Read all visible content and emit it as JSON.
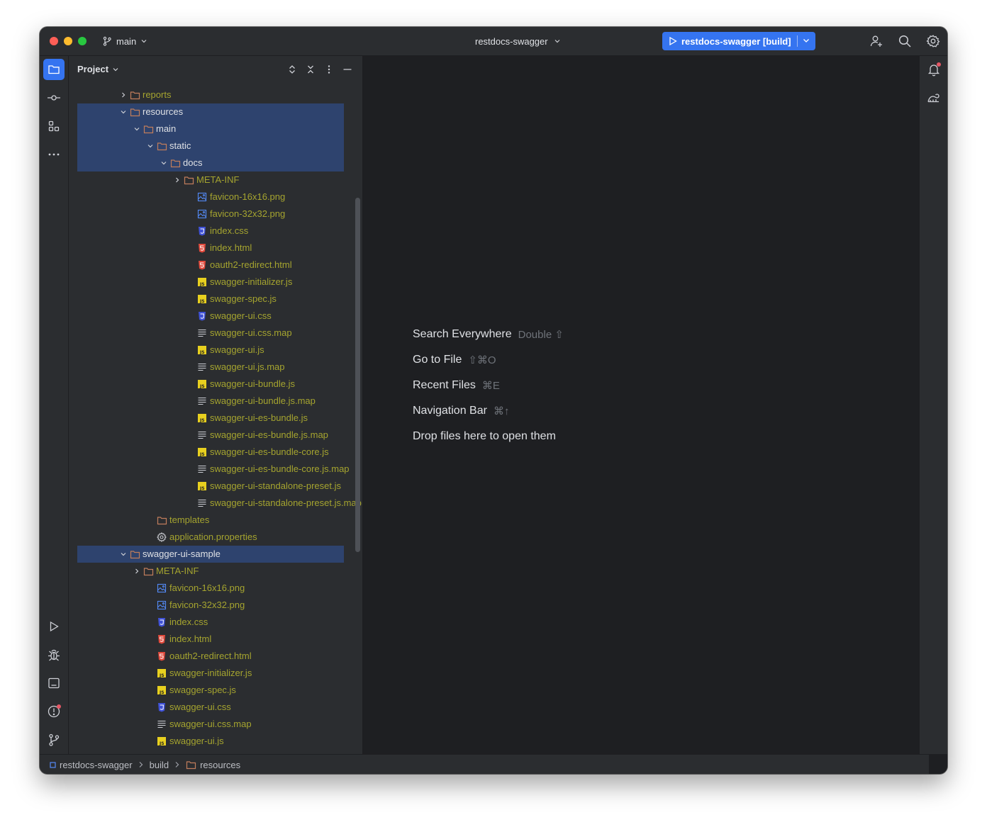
{
  "titlebar": {
    "branch": "main",
    "project": "restdocs-swagger",
    "run_config": "restdocs-swagger [build]"
  },
  "panel": {
    "title": "Project"
  },
  "tree": [
    {
      "label": "reports",
      "indent": 1,
      "arrow": "right",
      "icon": "folder-icon",
      "ignored": true
    },
    {
      "label": "resources",
      "indent": 1,
      "arrow": "down",
      "icon": "folder-icon",
      "ignored": false
    },
    {
      "label": "main",
      "indent": 2,
      "arrow": "down",
      "icon": "folder-icon",
      "ignored": false
    },
    {
      "label": "static",
      "indent": 3,
      "arrow": "down",
      "icon": "folder-icon",
      "ignored": false
    },
    {
      "label": "docs",
      "indent": 4,
      "arrow": "down",
      "icon": "folder-icon",
      "ignored": false
    },
    {
      "label": "META-INF",
      "indent": 5,
      "arrow": "right",
      "icon": "folder-icon",
      "ignored": true
    },
    {
      "label": "favicon-16x16.png",
      "indent": 6,
      "arrow": "",
      "icon": "image-file-icon",
      "ignored": true
    },
    {
      "label": "favicon-32x32.png",
      "indent": 6,
      "arrow": "",
      "icon": "image-file-icon",
      "ignored": true
    },
    {
      "label": "index.css",
      "indent": 6,
      "arrow": "",
      "icon": "css-file-icon",
      "ignored": true
    },
    {
      "label": "index.html",
      "indent": 6,
      "arrow": "",
      "icon": "html-file-icon",
      "ignored": true
    },
    {
      "label": "oauth2-redirect.html",
      "indent": 6,
      "arrow": "",
      "icon": "html-file-icon",
      "ignored": true
    },
    {
      "label": "swagger-initializer.js",
      "indent": 6,
      "arrow": "",
      "icon": "js-file-icon",
      "ignored": true
    },
    {
      "label": "swagger-spec.js",
      "indent": 6,
      "arrow": "",
      "icon": "js-file-icon",
      "ignored": true
    },
    {
      "label": "swagger-ui.css",
      "indent": 6,
      "arrow": "",
      "icon": "css-file-icon",
      "ignored": true
    },
    {
      "label": "swagger-ui.css.map",
      "indent": 6,
      "arrow": "",
      "icon": "text-file-icon",
      "ignored": true
    },
    {
      "label": "swagger-ui.js",
      "indent": 6,
      "arrow": "",
      "icon": "js-file-icon",
      "ignored": true
    },
    {
      "label": "swagger-ui.js.map",
      "indent": 6,
      "arrow": "",
      "icon": "text-file-icon",
      "ignored": true
    },
    {
      "label": "swagger-ui-bundle.js",
      "indent": 6,
      "arrow": "",
      "icon": "js-file-icon",
      "ignored": true
    },
    {
      "label": "swagger-ui-bundle.js.map",
      "indent": 6,
      "arrow": "",
      "icon": "text-file-icon",
      "ignored": true
    },
    {
      "label": "swagger-ui-es-bundle.js",
      "indent": 6,
      "arrow": "",
      "icon": "js-file-icon",
      "ignored": true
    },
    {
      "label": "swagger-ui-es-bundle.js.map",
      "indent": 6,
      "arrow": "",
      "icon": "text-file-icon",
      "ignored": true
    },
    {
      "label": "swagger-ui-es-bundle-core.js",
      "indent": 6,
      "arrow": "",
      "icon": "js-file-icon",
      "ignored": true
    },
    {
      "label": "swagger-ui-es-bundle-core.js.map",
      "indent": 6,
      "arrow": "",
      "icon": "text-file-icon",
      "ignored": true
    },
    {
      "label": "swagger-ui-standalone-preset.js",
      "indent": 6,
      "arrow": "",
      "icon": "js-file-icon",
      "ignored": true
    },
    {
      "label": "swagger-ui-standalone-preset.js.map",
      "indent": 6,
      "arrow": "",
      "icon": "text-file-icon",
      "ignored": true
    },
    {
      "label": "templates",
      "indent": 3,
      "arrow": "",
      "icon": "folder-icon",
      "ignored": true
    },
    {
      "label": "application.properties",
      "indent": 3,
      "arrow": "",
      "icon": "settings-file-icon",
      "ignored": true
    },
    {
      "label": "swagger-ui-sample",
      "indent": 1,
      "arrow": "down",
      "icon": "folder-icon",
      "ignored": false,
      "selected": true
    },
    {
      "label": "META-INF",
      "indent": 2,
      "arrow": "right",
      "icon": "folder-icon",
      "ignored": true
    },
    {
      "label": "favicon-16x16.png",
      "indent": 3,
      "arrow": "",
      "icon": "image-file-icon",
      "ignored": true
    },
    {
      "label": "favicon-32x32.png",
      "indent": 3,
      "arrow": "",
      "icon": "image-file-icon",
      "ignored": true
    },
    {
      "label": "index.css",
      "indent": 3,
      "arrow": "",
      "icon": "css-file-icon",
      "ignored": true
    },
    {
      "label": "index.html",
      "indent": 3,
      "arrow": "",
      "icon": "html-file-icon",
      "ignored": true
    },
    {
      "label": "oauth2-redirect.html",
      "indent": 3,
      "arrow": "",
      "icon": "html-file-icon",
      "ignored": true
    },
    {
      "label": "swagger-initializer.js",
      "indent": 3,
      "arrow": "",
      "icon": "js-file-icon",
      "ignored": true
    },
    {
      "label": "swagger-spec.js",
      "indent": 3,
      "arrow": "",
      "icon": "js-file-icon",
      "ignored": true
    },
    {
      "label": "swagger-ui.css",
      "indent": 3,
      "arrow": "",
      "icon": "css-file-icon",
      "ignored": true
    },
    {
      "label": "swagger-ui.css.map",
      "indent": 3,
      "arrow": "",
      "icon": "text-file-icon",
      "ignored": true
    },
    {
      "label": "swagger-ui.js",
      "indent": 3,
      "arrow": "",
      "icon": "js-file-icon",
      "ignored": true
    }
  ],
  "editor": {
    "hints": [
      {
        "label": "Search Everywhere",
        "shortcut": "Double ⇧"
      },
      {
        "label": "Go to File",
        "shortcut": "⇧⌘O"
      },
      {
        "label": "Recent Files",
        "shortcut": "⌘E"
      },
      {
        "label": "Navigation Bar",
        "shortcut": "⌘↑"
      },
      {
        "label": "Drop files here to open them",
        "shortcut": ""
      }
    ]
  },
  "statusbar": {
    "breadcrumbs": [
      "restdocs-swagger",
      "build",
      "resources"
    ]
  },
  "colors": {
    "accent": "#3574f0",
    "ignored_text": "#a5a42f",
    "selection": "#2e436e",
    "notification_badge": "#e55765"
  }
}
